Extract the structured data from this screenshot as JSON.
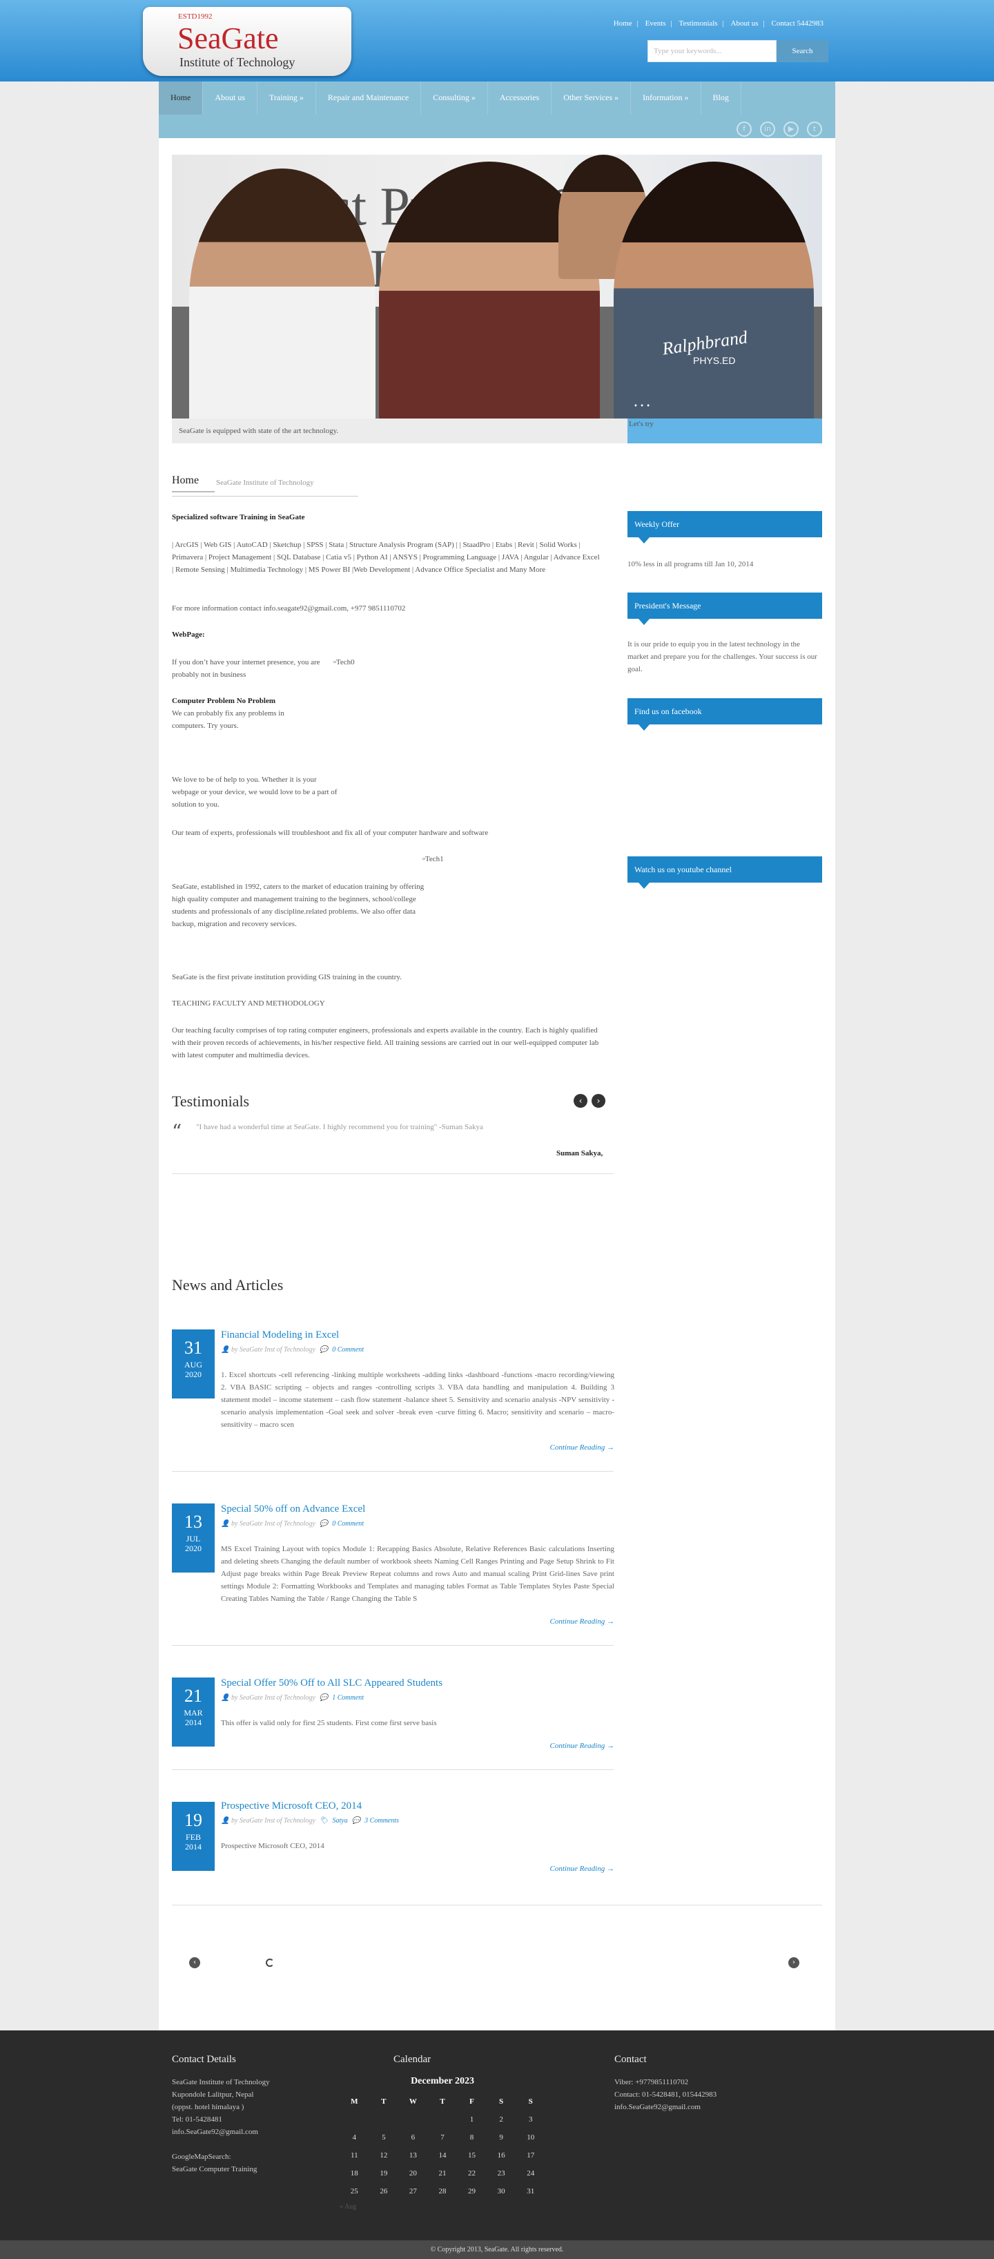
{
  "header": {
    "logo_estd": "ESTD1992",
    "logo_name": "SeaGate",
    "logo_subtitle": "Institute of Technology",
    "top_links": [
      "Home",
      "Events",
      "Testimonials",
      "About us",
      "Contact 5442983"
    ],
    "search_placeholder": "Type your keywords...",
    "search_button": "Search"
  },
  "nav": {
    "items": [
      "Home",
      "About us",
      "Training »",
      "Repair and Maintenance",
      "Consulting »",
      "Accessories",
      "Other Services »",
      "Information »",
      "Blog"
    ]
  },
  "slider": {
    "caption": "SeaGate is equipped with state of the art technology.",
    "caption_right": "Let's try",
    "wall_text": "st Private Centre GIS Traini",
    "shirt_text": "Ralphbrand",
    "shirt_sub": "PHYS.ED"
  },
  "breadcrumb": {
    "home": "Home",
    "site": "SeaGate Institute of Technology"
  },
  "content": {
    "heading": "Specialized software Training in SeaGate",
    "software_list": "| ArcGIS | Web GIS | AutoCAD | Sketchup | SPSS | Stata | Structure Analysis Program (SAP) | | StaadPro | Etabs | Revit | Solid Works | Primavera | Project Management | SQL Database | Catia v5 | Python AI | ANSYS | Programming Language | JAVA | Angular | Advance Excel | Remote Sensing | Multimedia Technology | MS Power BI |Web Development | Advance Office Specialist and Many More",
    "contact_line": "For more information contact info.seagate92@gmail.com, +977 9851110702",
    "webpage_label": "WebPage:",
    "webpage_text": "If you don’t have your internet presence, you are probably not in business",
    "tech0_alt": "Tech0",
    "problem_heading": "Computer Problem No Problem",
    "problem_text": "We can probably fix any problems in computers. Try yours.",
    "help_text": "We love to be of help to you. Whether it is your webpage or your device, we would love to be a part of solution to you.",
    "team_text": "Our team of experts, professionals will troubleshoot and fix all of your computer hardware and software",
    "tech1_alt": "Tech1",
    "established_text": "SeaGate, established in 1992, caters to the market of education training by offering high quality computer and management training to the beginners, school/college students and professionals of any discipline.related problems. We also offer data backup, migration and recovery services.",
    "gis_text": "SeaGate is the first private institution providing GIS training in the country.",
    "faculty_heading": "TEACHING FACULTY AND METHODOLOGY",
    "faculty_text": "Our teaching faculty comprises of top rating computer engineers, professionals and experts available in the country. Each is highly qualified with their proven records of achievements, in his/her respective field. All training sessions are carried out in our well-equipped computer lab with latest computer and multimedia devices."
  },
  "sidebar": {
    "weekly_title": "Weekly Offer",
    "weekly_text": "10% less in all programs till Jan 10, 2014",
    "president_title": "President's Message",
    "president_text": "It is our pride to equip you in the latest technology in the market and prepare you for the challenges. Your success is our goal.",
    "facebook_title": "Find us on facebook",
    "youtube_title": "Watch us on youtube channel"
  },
  "testimonials": {
    "title": "Testimonials",
    "quote": "\"I have had a wonderful time at SeaGate. I highly recommend you for training\" -Suman Sakya",
    "author": "Suman Sakya,"
  },
  "news": {
    "title": "News and Articles",
    "articles": [
      {
        "day": "31",
        "month": "AUG",
        "year": "2020",
        "title": "Financial Modeling in Excel",
        "author": "by SeaGate Inst of Technology",
        "tag": "",
        "comments": "0 Comment",
        "body": "1. Excel shortcuts -cell referencing -linking multiple worksheets -adding links -dashboard -functions -macro recording/viewing 2. VBA BASIC scripting – objects and ranges -controlling scripts 3. VBA data handling and manipulation 4. Building 3 statement model – income statement – cash flow statement -balance sheet 5. Sensitivity and scenario analysis -NPV sensitivity -scenario analysis implementation -Goal seek and solver -break even -curve fitting 6. Macro; sensitivity and scenario – macro-sensitivity – macro scen",
        "more": "Continue Reading →"
      },
      {
        "day": "13",
        "month": "JUL",
        "year": "2020",
        "title": "Special 50% off on Advance Excel",
        "author": "by SeaGate Inst of Technology",
        "tag": "",
        "comments": "0 Comment",
        "body": "MS Excel Training Layout with topics Module 1: Recapping Basics Absolute, Relative References Basic calculations Inserting and deleting sheets Changing the default number of workbook sheets Naming Cell Ranges Printing and Page Setup Shrink to Fit Adjust page breaks within Page Break Preview Repeat columns and rows Auto and manual scaling Print Grid-lines Save print settings Module 2: Formatting Workbooks and Templates and managing tables Format as Table Templates Styles Paste Special Creating Tables Naming the Table / Range Changing the Table S",
        "more": "Continue Reading →"
      },
      {
        "day": "21",
        "month": "MAR",
        "year": "2014",
        "title": "Special Offer 50% Off to All SLC Appeared Students",
        "author": "by SeaGate Inst of Technology",
        "tag": "",
        "comments": "1 Comment",
        "body": "This offer is valid only for first 25 students. First come first serve basis",
        "more": "Continue Reading →"
      },
      {
        "day": "19",
        "month": "FEB",
        "year": "2014",
        "title": "Prospective Microsoft CEO, 2014",
        "author": "by SeaGate Inst of Technology",
        "tag": "Satya",
        "comments": "3 Comments",
        "body": "Prospective Microsoft CEO, 2014",
        "more": "Continue Reading →"
      }
    ]
  },
  "footer": {
    "contact_title": "Contact Details",
    "contact_lines": [
      "SeaGate Institute of Technology",
      "Kupondole Lalitpur, Nepal",
      "(oppst. hotel himalaya )",
      "Tel: 01-5428481",
      "info.SeaGate92@gmail.com",
      "",
      "GoogleMapSearch:",
      "SeaGate Computer Training"
    ],
    "calendar_title": "Calendar",
    "calendar_month": "December 2023",
    "calendar_days": [
      "M",
      "T",
      "W",
      "T",
      "F",
      "S",
      "S"
    ],
    "calendar_rows": [
      [
        "",
        "",
        "",
        "",
        "1",
        "2",
        "3"
      ],
      [
        "4",
        "5",
        "6",
        "7",
        "8",
        "9",
        "10"
      ],
      [
        "11",
        "12",
        "13",
        "14",
        "15",
        "16",
        "17"
      ],
      [
        "18",
        "19",
        "20",
        "21",
        "22",
        "23",
        "24"
      ],
      [
        "25",
        "26",
        "27",
        "28",
        "29",
        "30",
        "31"
      ]
    ],
    "calendar_prev": "« Aug",
    "contact2_title": "Contact",
    "contact2_lines": [
      "Viber: +9779851110702",
      "Contact: 01-5428481, 015442983",
      "info.SeaGate92@gmail.com"
    ],
    "copyright": "© Copyright 2013, SeaGate. All rights reserved."
  },
  "colors": {
    "accent": "#1c86c9",
    "header": "#2a8ad2",
    "nav": "#8ac0d6",
    "footer": "#2b2b2b",
    "logo_red": "#c0252a"
  },
  "icons": [
    "facebook-icon",
    "linkedin-icon",
    "youtube-icon",
    "twitter-icon",
    "user-icon",
    "comment-icon",
    "tag-icon",
    "quote-icon"
  ]
}
